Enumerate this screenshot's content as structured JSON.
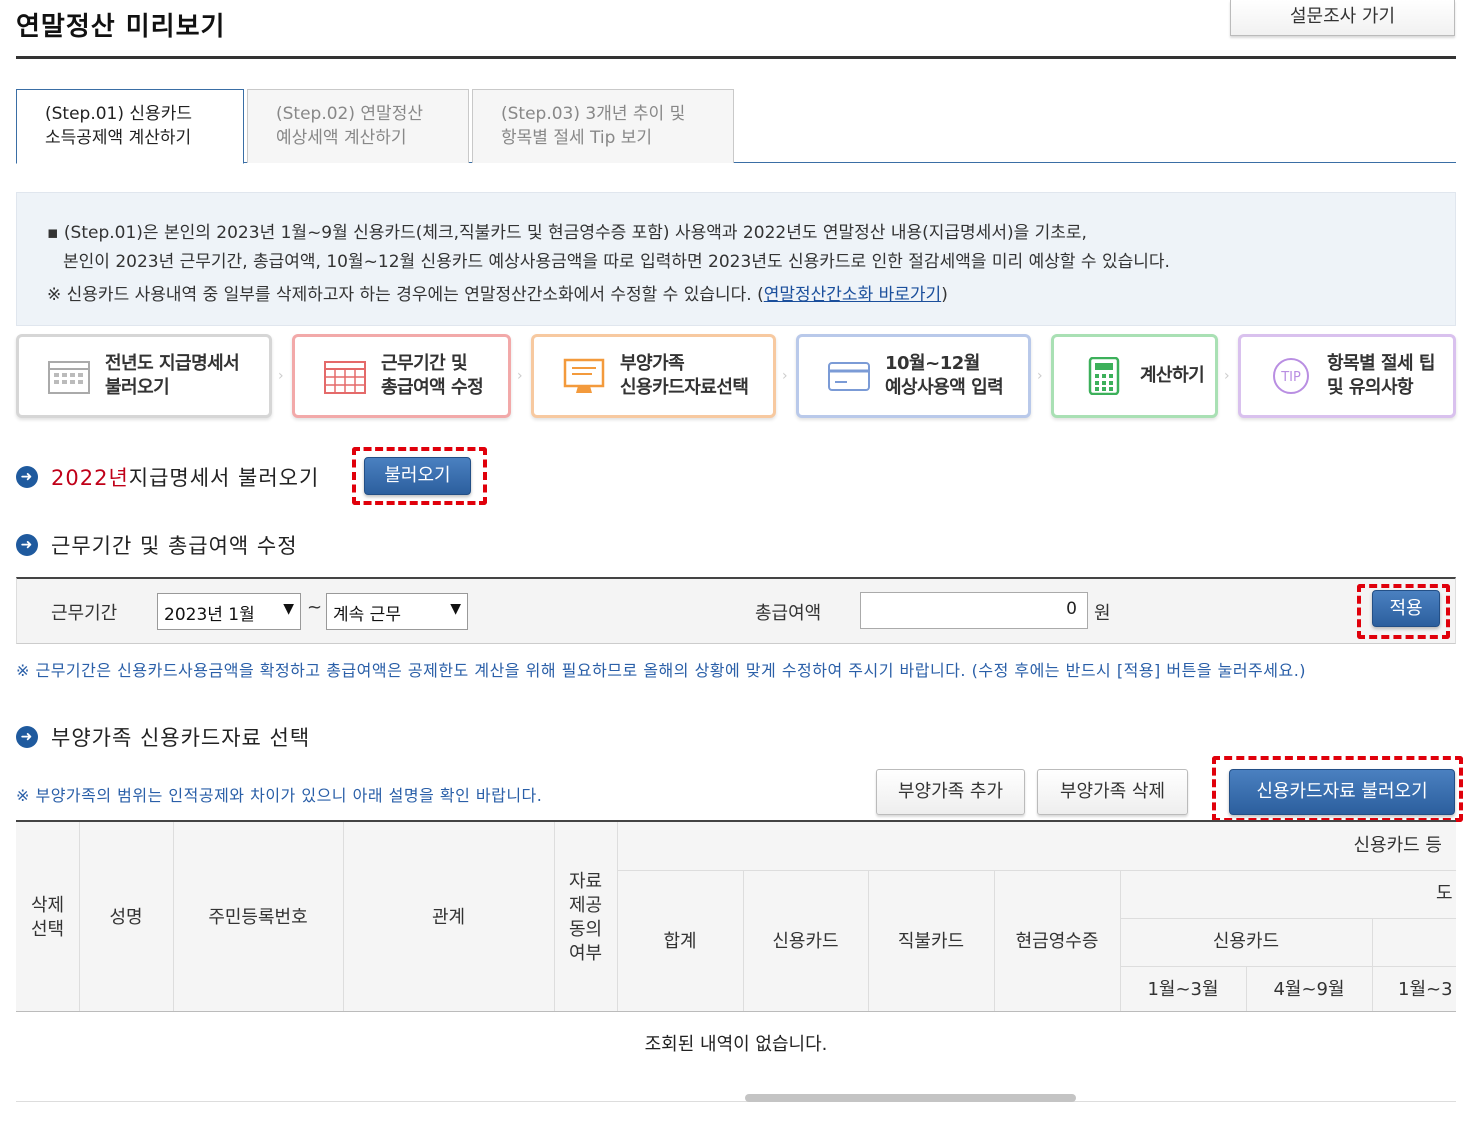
{
  "header": {
    "title": "연말정산 미리보기",
    "survey_button": "설문조사 가기"
  },
  "tabs": [
    {
      "line1": "(Step.01) 신용카드",
      "line2": "소득공제액 계산하기"
    },
    {
      "line1": "(Step.02) 연말정산",
      "line2": "예상세액 계산하기"
    },
    {
      "line1": "(Step.03) 3개년 추이 및",
      "line2": "항목별 절세 Tip 보기"
    }
  ],
  "info": {
    "line1": "▪ (Step.01)은 본인의 2023년 1월~9월 신용카드(체크,직불카드 및 현금영수증 포함) 사용액과 2022년도 연말정산 내용(지급명세서)을 기초로,",
    "line2": "본인이 2023년 근무기간, 총급여액, 10월~12월 신용카드 예상사용금액을 따로 입력하면 2023년도 신용카드로 인한 절감세액을 미리 예상할 수 있습니다.",
    "note_prefix": "※ 신용카드 사용내역 중 일부를 삭제하고자 하는 경우에는 연말정산간소화에서 수정할 수 있습니다. (",
    "note_link": "연말정산간소화 바로가기",
    "note_suffix": ")"
  },
  "steps": [
    {
      "line1": "전년도 지급명세서",
      "line2": "불러오기",
      "icon": "calendar-icon",
      "color": "#d6d6d6"
    },
    {
      "line1": "근무기간 및",
      "line2": "총급여액 수정",
      "icon": "calendar-grid-icon",
      "color": "#f2a9a9"
    },
    {
      "line1": "부양가족",
      "line2": "신용카드자료선택",
      "icon": "monitor-icon",
      "color": "#f7c9a0"
    },
    {
      "line1": "10월~12월",
      "line2": "예상사용액 입력",
      "icon": "card-icon",
      "color": "#b9c9ea"
    },
    {
      "line1": "계산하기",
      "line2": "",
      "icon": "calculator-icon",
      "color": "#a9e0b4"
    },
    {
      "line1": "항목별 절세 팁",
      "line2": "및 유의사항",
      "icon": "tip-icon",
      "color": "#d9c1ee"
    }
  ],
  "section1": {
    "year": "2022년",
    "title": " 지급명세서 불러오기",
    "button": "불러오기"
  },
  "section2": {
    "title": "근무기간 및 총급여액 수정",
    "period_label": "근무기간",
    "period_start": "2023년 1월",
    "tilde": "~",
    "period_end": "계속 근무",
    "salary_label": "총급여액",
    "salary_value": "0",
    "unit": "원",
    "apply_button": "적용",
    "hint": "※ 근무기간은 신용카드사용금액을 확정하고 총급여액은 공제한도 계산을 위해 필요하므로 올해의 상황에 맞게 수정하여 주시기 바랍니다. (수정 후에는 반드시 [적용] 버튼을 눌러주세요.)"
  },
  "section3": {
    "title": "부양가족 신용카드자료 선택",
    "hint": "※ 부양가족의 범위는 인적공제와 차이가 있으니 아래 설명을 확인 바랍니다.",
    "add_button": "부양가족 추가",
    "delete_button": "부양가족 삭제",
    "load_button": "신용카드자료 불러오기"
  },
  "table": {
    "col_delete": "삭제 선택",
    "col_name": "성명",
    "col_rrn": "주민등록번호",
    "col_relation": "관계",
    "col_consent": "자료 제공 동의 여부",
    "group_header": "신용카드 등",
    "col_total": "합계",
    "col_credit": "신용카드",
    "col_debit": "직불카드",
    "col_cash": "현금영수증",
    "sub_credit": "신용카드",
    "partial_header": "도",
    "m13": "1월~3월",
    "m49": "4월~9월",
    "m13b": "1월~3",
    "empty_message": "조회된 내역이 없습니다."
  }
}
